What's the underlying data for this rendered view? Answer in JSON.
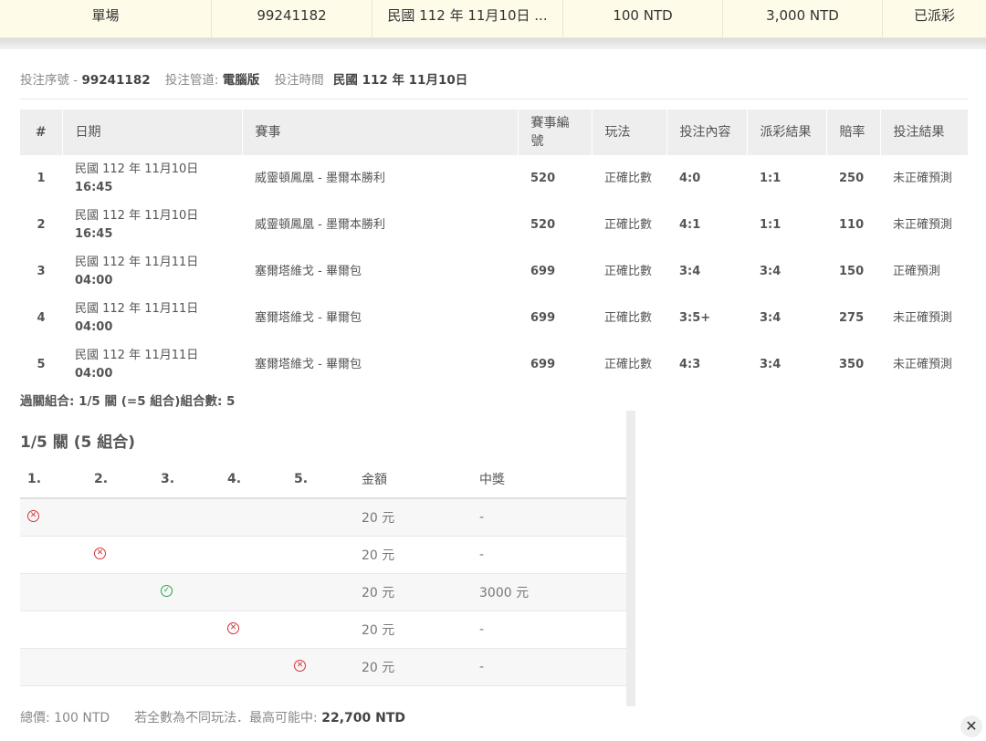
{
  "summary": {
    "type": "單場",
    "serial": "99241182",
    "date": "民國 112 年 11月10日 ...",
    "stake": "100 NTD",
    "payout": "3,000 NTD",
    "status": "已派彩"
  },
  "meta": {
    "serial_label": "投注序號 -",
    "serial_value": "99241182",
    "channel_label": "投注管道:",
    "channel_value": "電腦版",
    "time_label": "投注時間",
    "time_value": "民國 112 年 11月10日"
  },
  "table": {
    "headers": [
      "#",
      "日期",
      "賽事",
      "賽事編號",
      "玩法",
      "投注內容",
      "派彩結果",
      "賠率",
      "投注結果"
    ],
    "rows": [
      {
        "idx": "1",
        "date": "民國 112 年 11月10日",
        "time": "16:45",
        "match": "威靈頓鳳凰 - 墨爾本勝利",
        "id": "520",
        "play": "正確比數",
        "pick": "4:0",
        "result": "1:1",
        "odds": "250",
        "outcome": "未正確預測"
      },
      {
        "idx": "2",
        "date": "民國 112 年 11月10日",
        "time": "16:45",
        "match": "威靈頓鳳凰 - 墨爾本勝利",
        "id": "520",
        "play": "正確比數",
        "pick": "4:1",
        "result": "1:1",
        "odds": "110",
        "outcome": "未正確預測"
      },
      {
        "idx": "3",
        "date": "民國 112 年 11月11日",
        "time": "04:00",
        "match": "塞爾塔維戈 - 畢爾包",
        "id": "699",
        "play": "正確比數",
        "pick": "3:4",
        "result": "3:4",
        "odds": "150",
        "outcome": "正確預測"
      },
      {
        "idx": "4",
        "date": "民國 112 年 11月11日",
        "time": "04:00",
        "match": "塞爾塔維戈 - 畢爾包",
        "id": "699",
        "play": "正確比數",
        "pick": "3:5+",
        "result": "3:4",
        "odds": "275",
        "outcome": "未正確預測"
      },
      {
        "idx": "5",
        "date": "民國 112 年 11月11日",
        "time": "04:00",
        "match": "塞爾塔維戈 - 畢爾包",
        "id": "699",
        "play": "正確比數",
        "pick": "4:3",
        "result": "3:4",
        "odds": "350",
        "outcome": "未正確預測"
      }
    ]
  },
  "combo_summary": "過關組合: 1/5 關 (=5 組合)組合數: 5",
  "combo": {
    "title": "1/5 關 (5 組合)",
    "headers": [
      "1.",
      "2.",
      "3.",
      "4.",
      "5.",
      "金額",
      "中獎"
    ],
    "rows": [
      {
        "col": 1,
        "mark": "x",
        "amount": "20 元",
        "win": "-"
      },
      {
        "col": 2,
        "mark": "x",
        "amount": "20 元",
        "win": "-"
      },
      {
        "col": 3,
        "mark": "ok",
        "amount": "20 元",
        "win": "3000 元"
      },
      {
        "col": 4,
        "mark": "x",
        "amount": "20 元",
        "win": "-"
      },
      {
        "col": 5,
        "mark": "x",
        "amount": "20 元",
        "win": "-"
      }
    ]
  },
  "footer": {
    "total_label": "總價:",
    "total_value": "100 NTD",
    "max_label": "若全數為不同玩法．最高可能中:",
    "max_value": "22,700 NTD"
  },
  "close_icon": "close-icon"
}
